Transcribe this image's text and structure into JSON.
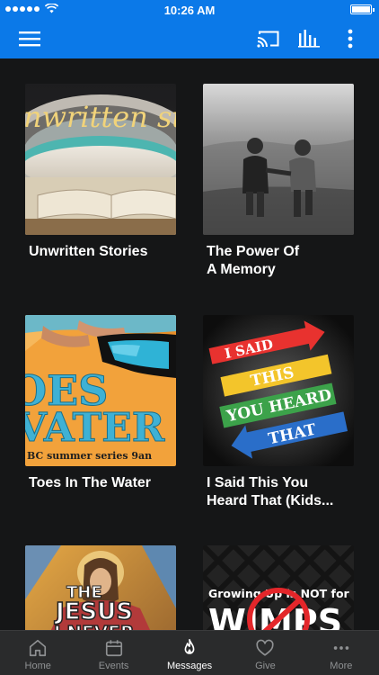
{
  "status_bar": {
    "time": "10:26 AM"
  },
  "app_bar": {
    "icons": [
      "menu-icon",
      "cast-icon",
      "audio-bars-icon",
      "more-vertical-icon"
    ]
  },
  "messages": [
    {
      "title": "Unwritten Stories",
      "art_text": "nwritten sto"
    },
    {
      "title": "The Power Of\nA Memory",
      "art_text": ""
    },
    {
      "title": "Toes In The Water",
      "art_text_1": "OES",
      "art_text_2": "VATER",
      "art_text_3": "BC summer series 9an"
    },
    {
      "title": "I Said This You\nHeard That (Kids...",
      "art_text_1": "I SAID",
      "art_text_2": "THIS",
      "art_text_3": "YOU HEARD",
      "art_text_4": "THAT"
    },
    {
      "title": "",
      "art_text_1": "THE",
      "art_text_2": "JESUS",
      "art_text_3": "I NEVER"
    },
    {
      "title": "",
      "art_text_1": "Growing Up is NOT for",
      "art_text_2": "WIMPS"
    }
  ],
  "tabs": [
    {
      "label": "Home",
      "icon": "home-icon",
      "active": false
    },
    {
      "label": "Events",
      "icon": "calendar-icon",
      "active": false
    },
    {
      "label": "Messages",
      "icon": "flame-icon",
      "active": true
    },
    {
      "label": "Give",
      "icon": "heart-icon",
      "active": false
    },
    {
      "label": "More",
      "icon": "more-horizontal-icon",
      "active": false
    }
  ]
}
